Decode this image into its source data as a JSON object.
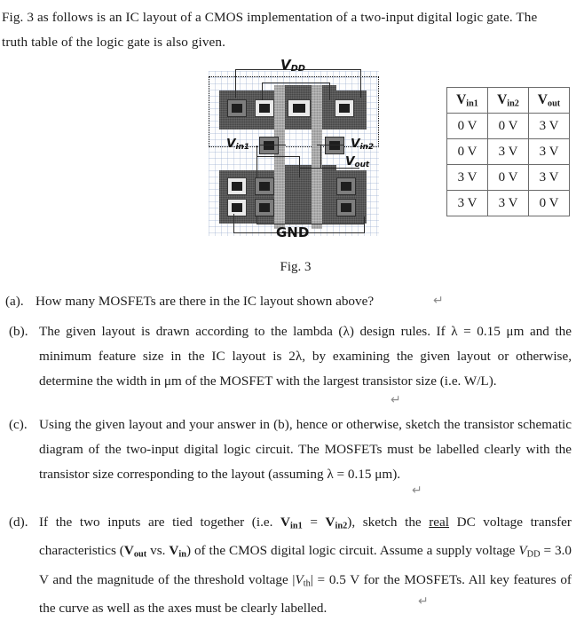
{
  "document": {
    "intro": {
      "line1": "Fig. 3 as follows is an IC layout of a CMOS implementation of a two-input digital logic gate. The",
      "line2": "truth table of the logic gate is also given."
    },
    "figure_caption": "Fig. 3",
    "return_mark": "↵"
  },
  "layout": {
    "labels": {
      "vdd": "V",
      "vdd_sub": "DD",
      "vin1": "V",
      "vin1_sub": "in1",
      "vin2": "V",
      "vin2_sub": "in2",
      "vout": "V",
      "vout_sub": "out",
      "gnd": "GND"
    }
  },
  "truth_table": {
    "headers": [
      "V₁",
      "V₂",
      "Vₒ"
    ],
    "header_main": [
      "V",
      "V",
      "V"
    ],
    "header_sub": [
      "in1",
      "in2",
      "out"
    ],
    "rows": [
      [
        "0 V",
        "0 V",
        "3 V"
      ],
      [
        "0 V",
        "3 V",
        "3 V"
      ],
      [
        "3 V",
        "0 V",
        "3 V"
      ],
      [
        "3 V",
        "3 V",
        "0 V"
      ]
    ]
  },
  "questions": [
    {
      "label": "(a).",
      "text": "How many MOSFETs are there in the IC layout shown above?"
    },
    {
      "label": "(b).",
      "text_p1": "The given layout is drawn according to the lambda (λ) design rules. If λ = 0.15 μm and the minimum feature size in the IC layout is 2λ, by examining the given layout or otherwise, determine the width in μm of the MOSFET with the largest transistor size (i.e. W/L)."
    },
    {
      "label": "(c).",
      "text_p1": "Using the given layout and your answer in (b), hence or otherwise, sketch the transistor schematic diagram of the two-input digital logic circuit. The MOSFETs must be labelled clearly with the transistor size corresponding to the layout (assuming λ = 0.15 μm)."
    },
    {
      "label": "(d).",
      "pre": "If the two inputs are tied together (i.e. ",
      "vin1": "V",
      "vin1_sub": "in1",
      "eq": " = ",
      "vin2": "V",
      "vin2_sub": "in2",
      "mid1": "), sketch the ",
      "real": "real",
      "mid2": " DC voltage transfer characteristics (",
      "vout": "V",
      "vout_sub": "out",
      "vs": " vs. ",
      "vin": "V",
      "vin_sub": "in",
      "mid3": ") of the CMOS digital logic circuit. Assume a supply voltage ",
      "vdd": "V",
      "vdd_sub": "DD",
      "mid4": " = 3.0 V and the magnitude of the threshold voltage |",
      "vth": "V",
      "vth_sub": "th",
      "mid5": "| = 0.5 V for the MOSFETs. All key features of the curve as well as the axes must be clearly labelled."
    }
  ]
}
